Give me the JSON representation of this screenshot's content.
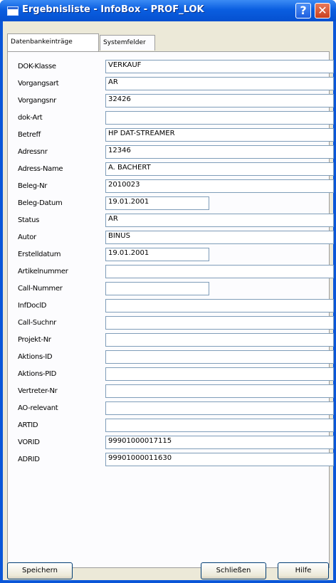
{
  "window": {
    "title": "Ergebnisliste - InfoBox - PROF_LOK",
    "help_label": "?",
    "close_label": "✕"
  },
  "tabs": [
    {
      "label": "Datenbankeinträge",
      "active": true
    },
    {
      "label": "Systemfelder",
      "active": false
    }
  ],
  "fields": [
    {
      "label": "DOK-Klasse",
      "value": "VERKAUF"
    },
    {
      "label": "Vorgangsart",
      "value": "AR"
    },
    {
      "label": "Vorgangsnr",
      "value": "32426"
    },
    {
      "label": "dok-Art",
      "value": ""
    },
    {
      "label": "Betreff",
      "value": "HP DAT-STREAMER"
    },
    {
      "label": "Adressnr",
      "value": "12346"
    },
    {
      "label": "Adress-Name",
      "value": "A. BACHERT"
    },
    {
      "label": "Beleg-Nr",
      "value": "2010023"
    },
    {
      "label": "Beleg-Datum",
      "value": "19.01.2001"
    },
    {
      "label": "Status",
      "value": "AR"
    },
    {
      "label": "Autor",
      "value": "BINUS"
    },
    {
      "label": "Erstelldatum",
      "value": "19.01.2001"
    },
    {
      "label": "Artikelnummer",
      "value": ""
    },
    {
      "label": "Call-Nummer",
      "value": ""
    },
    {
      "label": "InfDoclD",
      "value": ""
    },
    {
      "label": "Call-Suchnr",
      "value": ""
    },
    {
      "label": "Projekt-Nr",
      "value": ""
    },
    {
      "label": "Aktions-ID",
      "value": ""
    },
    {
      "label": "Aktions-PID",
      "value": ""
    },
    {
      "label": "Vertreter-Nr",
      "value": ""
    },
    {
      "label": "AO-relevant",
      "value": ""
    },
    {
      "label": "ARTID",
      "value": ""
    },
    {
      "label": "VORID",
      "value": "99901000017115"
    },
    {
      "label": "ADRID",
      "value": "99901000011630"
    }
  ],
  "buttons": {
    "save": "Speichern",
    "close": "Schließen",
    "help": "Hilfe"
  }
}
